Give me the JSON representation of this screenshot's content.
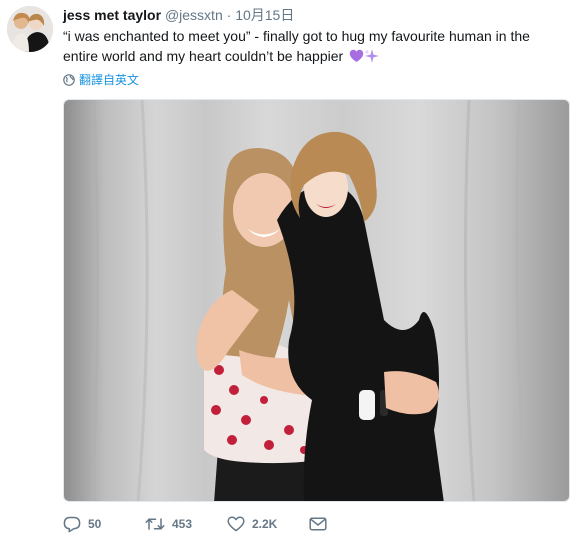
{
  "tweet": {
    "author_name": "jess met taylor",
    "author_handle": "@jessxtn",
    "separator": "·",
    "date": "10月15日",
    "text": "“i was enchanted to meet you” - finally got to hug my favourite human in the entire world and my heart couldn’t be happier",
    "translate_label": "翻譯自英文"
  },
  "icons": {
    "avatar": "avatar",
    "emoji_1": "purple-heart-icon",
    "emoji_2": "sparkles-icon",
    "translate": "globe-icon",
    "reply": "reply-icon",
    "retweet": "retweet-icon",
    "like": "heart-icon",
    "dm": "envelope-icon"
  },
  "actions": {
    "reply_count": "50",
    "retweet_count": "453",
    "like_count": "2.2K"
  },
  "colors": {
    "text": "#14171a",
    "muted": "#657786",
    "link": "#1b95e0",
    "purple_heart": "#a66ee0",
    "sparkle": "#b28cf0"
  }
}
